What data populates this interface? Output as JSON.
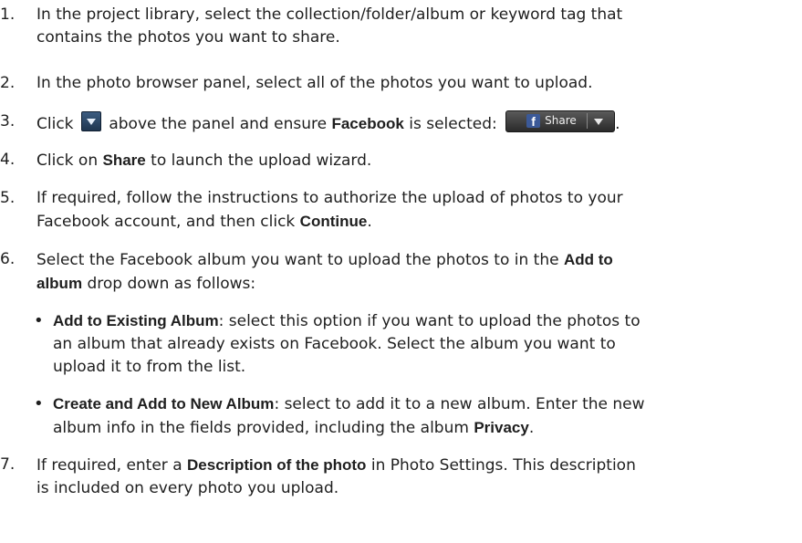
{
  "steps": [
    {
      "num": "1.",
      "lines": [
        "In the project library, select the collection/folder/album or keyword tag that",
        "contains the photos you want to share."
      ]
    },
    {
      "num": "2.",
      "text": "In the photo browser panel, select all of the photos you want to upload."
    },
    {
      "num": "3.",
      "a": "Click",
      "b": "above the panel and ensure",
      "bold": "Facebook",
      "c": "is selected:",
      "end": "."
    },
    {
      "num": "4.",
      "a": "Click on",
      "bold": "Share",
      "b": "to launch the upload wizard."
    },
    {
      "num": "5.",
      "l1": "If required, follow the instructions to authorize the upload of photos to your",
      "l2a": "Facebook account, and then click",
      "bold": "Continue",
      "l2b": "."
    },
    {
      "num": "6.",
      "l1a": "Select the Facebook album you want to upload the photos to in the",
      "bold1": "Add to",
      "bold2": "album",
      "l2b": "drop down as follows:"
    },
    {
      "num": "7.",
      "l1a": "If required, enter a",
      "bold": "Description of the photo",
      "l1b": "in Photo Settings. This description",
      "l2": "is included on every photo you upload."
    }
  ],
  "bullets": [
    {
      "bullet": "•",
      "bold": "Add to Existing Album",
      "l1": ": select this option if you want to upload the photos to",
      "l2": "an album that already exists on Facebook. Select the album you want to",
      "l3": "upload it to from the list."
    },
    {
      "bullet": "•",
      "bold": "Create and Add to New Album",
      "l1": ": select to add it to a new album. Enter the new",
      "l2a": "album info in the fields provided, including the album",
      "bold2": "Privacy",
      "l2b": "."
    }
  ],
  "share_control": {
    "icon_letter": "f",
    "label": "Share",
    "icon": "facebook-icon",
    "arrow": "chevron-down-icon"
  },
  "colors": {
    "facebook": "#3b5998",
    "button_dark": "#1f3650",
    "text": "#1e1e1e"
  }
}
